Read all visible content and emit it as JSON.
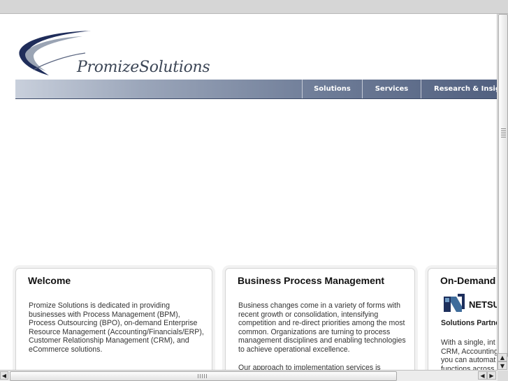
{
  "brand": {
    "logo_text": "PromizeSolutions",
    "colors": {
      "swoosh_dark": "#1f2d5a",
      "swoosh_light": "#9aa4b4",
      "nav_dark": "#4e5d7d"
    }
  },
  "nav": {
    "items": [
      {
        "label": "Solutions"
      },
      {
        "label": "Services"
      },
      {
        "label": "Research & Insigh"
      }
    ]
  },
  "panels": {
    "welcome": {
      "title": "Welcome",
      "body": "Promize Solutions is dedicated in providing businesses with Process Management (BPM), Process Outsourcing (BPO), on-demand Enterprise Resource Management (Accounting/Financials/ERP), Customer Relationship Management (CRM), and eCommerce solutions."
    },
    "bpm": {
      "title": "Business Process Management",
      "body": "Business changes come in a variety of forms with recent growth or consolidation, intensifying competition and re-direct priorities among the most common. Organizations are turning to process management disciplines and enabling technologies to achieve operational excellence.",
      "body2": "Our approach to implementation services is"
    },
    "ondemand": {
      "title": "On-Demand",
      "partner_logo_text": "NETSU",
      "partner_label": "Solutions Partne",
      "body": "With a single, int CRM, Accounting you can automat functions across"
    }
  },
  "icons": {
    "scroll_up": "▲",
    "scroll_down": "▼",
    "scroll_left": "◀",
    "scroll_right": "▶"
  }
}
